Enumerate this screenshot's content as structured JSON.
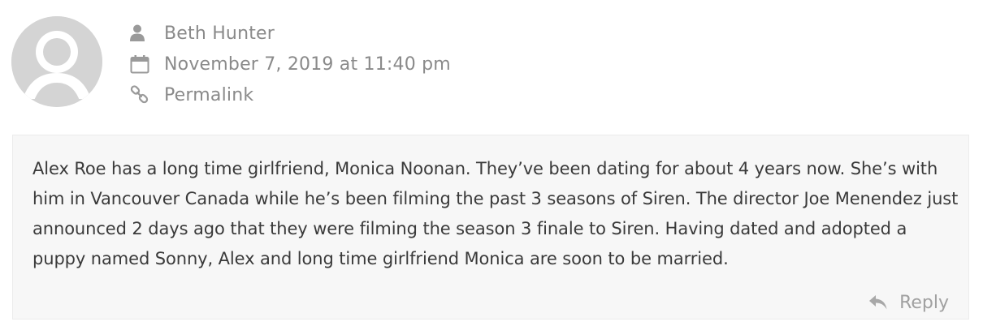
{
  "comment": {
    "author": "Beth Hunter",
    "date": "November 7, 2019 at 11:40 pm",
    "permalink_label": "Permalink",
    "body": "Alex Roe has a long time girlfriend, Monica Noonan. They’ve been dating for about 4 years now. She’s with him in Vancouver Canada while he’s been filming the past 3 seasons of Siren. The director Joe Menendez just announced 2 days ago that they were filming the season 3 finale to Siren. Having dated and adopted a puppy named Sonny, Alex and long time girlfriend Monica are soon to be married.",
    "reply_label": "Reply"
  },
  "icons": {
    "author": "user-icon",
    "date": "calendar-icon",
    "permalink": "link-icon",
    "reply": "reply-icon",
    "avatar": "default-avatar"
  },
  "colors": {
    "meta_text": "#8a8a8a",
    "avatar_bg": "#d4d4d4",
    "box_bg": "#f7f7f7"
  }
}
